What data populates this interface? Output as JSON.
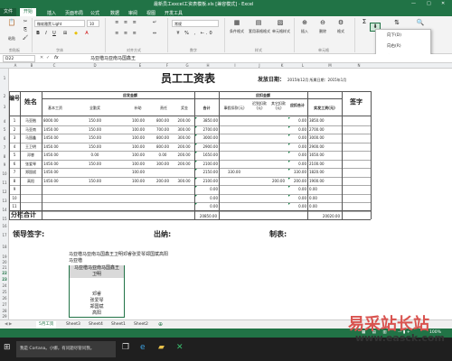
{
  "window": {
    "title": "最新员工excel工资表模板.xls [兼容模式] - Excel",
    "min": "—",
    "max": "□",
    "close": "✕"
  },
  "ribbon_tabs": [
    "文件",
    "开始",
    "插入",
    "页面布局",
    "公式",
    "数据",
    "审阅",
    "视图",
    "开发工具"
  ],
  "ribbon": {
    "font_name": "微软雅黑 Light",
    "font_size": "10",
    "number_format": "常规",
    "groups": [
      "剪贴板",
      "字体",
      "对齐方式",
      "数字",
      "样式",
      "单元格",
      "编辑"
    ],
    "buttons": {
      "paste": "粘贴",
      "cond_format": "条件格式",
      "table_format": "套用表格格式",
      "cell_style": "单元格样式",
      "insert": "插入",
      "delete": "删除",
      "format": "格式",
      "sort": "排序和筛选",
      "find": "查找和选择"
    }
  },
  "formula_bar": {
    "name_box": "D22",
    "fx": "fx",
    "content": "马亚楷马亚南马国鑫王"
  },
  "columns": [
    "A",
    "B",
    "C",
    "D",
    "E",
    "F",
    "G",
    "H",
    "I",
    "J",
    "K",
    "L",
    "M",
    "N"
  ],
  "rows": [
    "1",
    "2",
    "3",
    "4",
    "5",
    "6",
    "7",
    "8",
    "9",
    "10",
    "11",
    "12",
    "13",
    "14",
    "15",
    "16",
    "17",
    "18",
    "19",
    "20",
    "21",
    "22",
    "23",
    "24",
    "25",
    "26",
    "27",
    "28",
    "29"
  ],
  "sheet": {
    "title": "员工工资表",
    "issue_date_label": "发放日期：",
    "issue_date": "2015年12月 所属日期：2015年1月",
    "hdr_no": "编号",
    "hdr_name": "姓名",
    "hdr_payable": "应发金额",
    "hdr_deduct": "应扣金额",
    "hdr_sub": [
      "基本工资",
      "全勤奖",
      "补助",
      "责任",
      "奖金",
      "合计",
      "事假扣款(元)",
      "迟到扣款(元)",
      "其它扣款(元)",
      "应扣合计",
      "实发工资(元)"
    ],
    "hdr_sign": "签字",
    "rows": [
      {
        "no": "1",
        "name": "马亚楷",
        "base": "8000.00",
        "full": "150.00",
        "sub": "100.00",
        "resp": "800.00",
        "bonus": "200.00",
        "total": "3850.00",
        "leave": "",
        "late": "",
        "other": "",
        "dsum": "0.00",
        "net": "3850.00"
      },
      {
        "no": "2",
        "name": "马亚南",
        "base": "1450.00",
        "full": "150.00",
        "sub": "100.00",
        "resp": "700.00",
        "bonus": "300.00",
        "total": "2700.00",
        "leave": "",
        "late": "",
        "other": "",
        "dsum": "0.00",
        "net": "2700.00"
      },
      {
        "no": "3",
        "name": "马国鑫",
        "base": "1450.00",
        "full": "150.00",
        "sub": "100.00",
        "resp": "800.00",
        "bonus": "300.00",
        "total": "3000.00",
        "leave": "",
        "late": "",
        "other": "",
        "dsum": "0.00",
        "net": "3000.00"
      },
      {
        "no": "4",
        "name": "王卫明",
        "base": "1450.00",
        "full": "150.00",
        "sub": "100.00",
        "resp": "800.00",
        "bonus": "200.00",
        "total": "2900.00",
        "leave": "",
        "late": "",
        "other": "",
        "dsum": "0.00",
        "net": "2900.00"
      },
      {
        "no": "5",
        "name": "邓睿",
        "base": "1450.00",
        "full": "0.00",
        "sub": "100.00",
        "resp": "0.00",
        "bonus": "200.00",
        "total": "1650.00",
        "leave": "",
        "late": "",
        "other": "",
        "dsum": "0.00",
        "net": "1650.00"
      },
      {
        "no": "6",
        "name": "张爱琴",
        "base": "1450.00",
        "full": "150.00",
        "sub": "100.00",
        "resp": "300.00",
        "bonus": "200.00",
        "total": "2100.00",
        "leave": "",
        "late": "",
        "other": "",
        "dsum": "0.00",
        "net": "2100.00"
      },
      {
        "no": "7",
        "name": "郑国斌",
        "base": "1450.00",
        "full": "",
        "sub": "100.00",
        "resp": "",
        "bonus": "",
        "total": "2150.00",
        "leave": "330.00",
        "late": "",
        "other": "",
        "dsum": "330.00",
        "net": "1820.00"
      },
      {
        "no": "8",
        "name": "高阳",
        "base": "1450.00",
        "full": "150.00",
        "sub": "100.00",
        "resp": "200.00",
        "bonus": "300.00",
        "total": "2100.00",
        "leave": "",
        "late": "",
        "other": "200.00",
        "dsum": "200.00",
        "net": "1900.00"
      },
      {
        "no": "9",
        "name": "",
        "base": "",
        "full": "",
        "sub": "",
        "resp": "",
        "bonus": "",
        "total": "0.00",
        "leave": "",
        "late": "",
        "other": "",
        "dsum": "0.00",
        "net": "0.00"
      },
      {
        "no": "10",
        "name": "",
        "base": "",
        "full": "",
        "sub": "",
        "resp": "",
        "bonus": "",
        "total": "0.00",
        "leave": "",
        "late": "",
        "other": "",
        "dsum": "0.00",
        "net": "0.00"
      },
      {
        "no": "11",
        "name": "",
        "base": "",
        "full": "",
        "sub": "",
        "resp": "",
        "bonus": "",
        "total": "0.00",
        "leave": "",
        "late": "",
        "other": "",
        "dsum": "0.00",
        "net": "0.00"
      }
    ],
    "subtotal_label": "分栏合计",
    "subtotal_total": "20850.00",
    "subtotal_net": "20020.00",
    "sig_leader": "领导签字:",
    "sig_cashier": "出纳:",
    "sig_preparer": "制表:",
    "concat_text": "马亚楷马亚南马国鑫王卫明邓睿张爱琴郑国斌高阳",
    "b21_text": "马亚楷",
    "d22_text": "马亚楷马亚南马国鑫王",
    "d23_text": "卫明",
    "list_names": [
      "邓睿",
      "张爱琴",
      "郑国斌",
      "高阳"
    ]
  },
  "popup_menu": {
    "items": [
      "向下(D)",
      "向右(R)",
      "向上(U)",
      "向左(L)",
      "序列(S)...",
      "两端对齐(J)",
      "快速填充(F)"
    ],
    "selected": "两端对齐(J)",
    "tooltip": "内容重排"
  },
  "sheet_tabs": [
    "5月工资",
    "Sheet3",
    "Sheet4",
    "Sheet1",
    "Sheet2"
  ],
  "active_sheet": "5月工资",
  "status": {
    "zoom": "100%"
  },
  "taskbar": {
    "search": "我是 Cortana。小娜，有问题尽管问我。"
  },
  "watermark": {
    "cn": "易采站长站",
    "url": "www.easck.com"
  }
}
